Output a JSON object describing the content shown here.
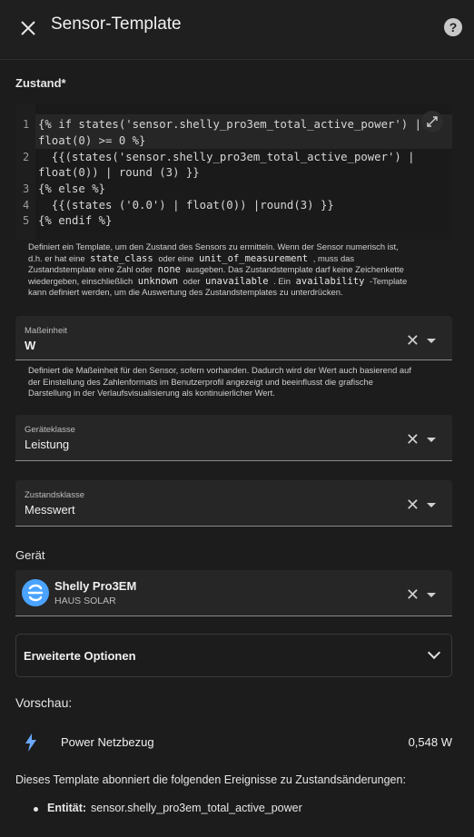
{
  "header": {
    "title": "Sensor-Template",
    "close_icon": "close-icon",
    "help_icon": "help-icon"
  },
  "state": {
    "label": "Zustand*",
    "code_lines": [
      "{% if states('sensor.shelly_pro3em_total_active_power') |",
      "float(0) >= 0 %}",
      "  {{(states('sensor.shelly_pro3em_total_active_power') |",
      "float(0)) | round (3) }}",
      "{% else %}",
      "  {{(states ('0.0') | float(0)) |round(3) }}",
      "{% endif %}"
    ],
    "line_numbers": [
      "1",
      "2",
      "3",
      "4",
      "5"
    ],
    "helper": {
      "p1": "Definiert ein Template, um den Zustand des Sensors zu ermitteln. Wenn der Sensor numerisch ist,",
      "p2": "d.h. er hat eine",
      "c1": "state_class",
      "p3": "oder eine",
      "c2": "unit_of_measurement",
      "p4": ", muss das",
      "p5": "Zustandstemplate eine Zahl oder",
      "c3": "none",
      "p6": "ausgeben. Das Zustandstemplate darf keine Zeichenkette",
      "p7": "wiedergeben, einschließlich",
      "c4": "unknown",
      "p8": "oder",
      "c5": "unavailable",
      "p9": ". Ein",
      "c6": "availability",
      "p10": "-Template",
      "p11": "kann definiert werden, um die Auswertung des Zustandstemplates zu unterdrücken."
    }
  },
  "unit": {
    "label": "Maßeinheit",
    "value": "W",
    "helper1": "Definiert die Maßeinheit für den Sensor, sofern vorhanden. Dadurch wird der Wert auch basierend auf",
    "helper2": "der Einstellung des Zahlenformats im Benutzerprofil angezeigt und beeinflusst die grafische",
    "helper3": "Darstellung in der Verlaufsvisualisierung als kontinuierlicher Wert."
  },
  "device_class": {
    "label": "Geräteklasse",
    "value": "Leistung"
  },
  "state_class": {
    "label": "Zustandsklasse",
    "value": "Messwert"
  },
  "device": {
    "section_label": "Gerät",
    "name": "Shelly Pro3EM",
    "area": "HAUS SOLAR"
  },
  "advanced": {
    "label": "Erweiterte Optionen"
  },
  "preview": {
    "title": "Vorschau:",
    "entity_name": "Power Netzbezug",
    "value": "0,548 W",
    "info": "Dieses Template abonniert die folgenden Ereignisse zu Zustandsänderungen:",
    "entity_key": "Entität:",
    "entity_id": "sensor.shelly_pro3em_total_active_power"
  },
  "colors": {
    "background": "#1c1c1c",
    "field": "#262626",
    "accent": "#4aa3ff"
  }
}
